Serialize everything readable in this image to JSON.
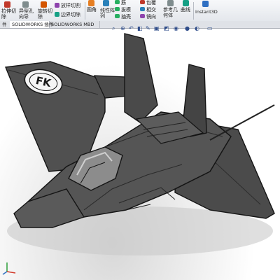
{
  "ribbon": {
    "btn_extrude_cut": "拉伸切\n除",
    "btn_hole_wizard": "异型孔\n向导",
    "btn_revolve_cut": "旋转切\n除",
    "btn_loft_cut": "放样切割",
    "btn_boundary_cut": "边界切除",
    "btn_fillet": "圆角",
    "btn_linear_pattern": "线性阵\n列",
    "btn_rib": "筋",
    "btn_draft": "拔模",
    "btn_shell": "抽壳",
    "btn_wrap": "包覆",
    "btn_intersect": "相交",
    "btn_mirror": "镜向",
    "btn_ref_geometry": "参考几\n何体",
    "btn_curves": "曲线",
    "btn_instant3d": "Instant3D"
  },
  "tabs": [
    {
      "label": "件"
    },
    {
      "label": "SOLIDWORKS 插件"
    },
    {
      "label": "SOLIDWORKS MBD"
    }
  ],
  "model": {
    "roundel_text": "FK"
  },
  "colors": {
    "accent": "#2f6fc2",
    "body": "#4a4a4a",
    "edge": "#151515"
  }
}
